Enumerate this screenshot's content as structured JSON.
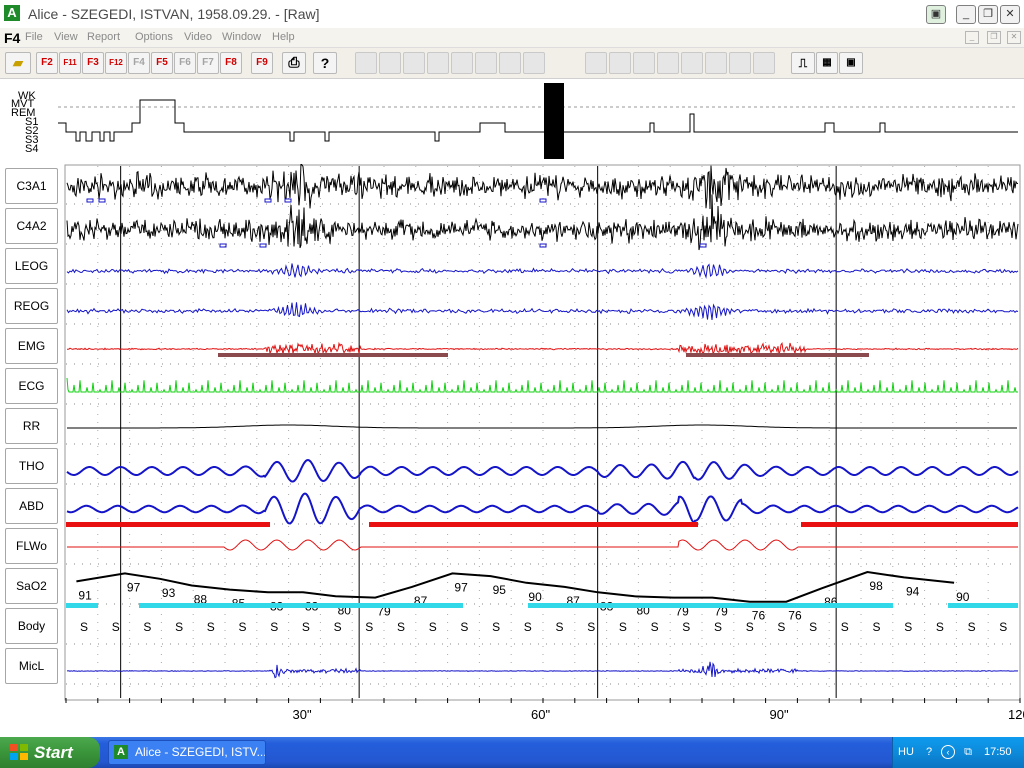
{
  "window": {
    "app_icon": "A",
    "title": "Alice - SZEGEDI, ISTVAN, 1958.09.29.  - [Raw]"
  },
  "menu": {
    "logo": "F4",
    "items": [
      "File",
      "View",
      "Report",
      "Options",
      "Video",
      "Window",
      "Help"
    ]
  },
  "toolbar": {
    "buttons": [
      "F2",
      "F11",
      "F3",
      "F12",
      "F4",
      "F5",
      "F6",
      "F7",
      "F8",
      "F9"
    ]
  },
  "hypnogram": {
    "stages": [
      "WK",
      "MVT",
      "REM",
      "S1",
      "S2",
      "S3",
      "S4"
    ]
  },
  "channels": [
    "C3A1",
    "C4A2",
    "LEOG",
    "REOG",
    "EMG",
    "ECG",
    "RR",
    "THO",
    "ABD",
    "FLWo",
    "SaO2",
    "Body",
    "MicL"
  ],
  "sao2": {
    "values": [
      {
        "t": 0.3,
        "v": "91"
      },
      {
        "t": 6.4,
        "v": "97"
      },
      {
        "t": 10.8,
        "v": "93"
      },
      {
        "t": 14.8,
        "v": "88"
      },
      {
        "t": 19.6,
        "v": "85"
      },
      {
        "t": 24.4,
        "v": "83"
      },
      {
        "t": 28.8,
        "v": "83"
      },
      {
        "t": 32.9,
        "v": "80"
      },
      {
        "t": 37.9,
        "v": "79"
      },
      {
        "t": 42.5,
        "v": "87"
      },
      {
        "t": 47.6,
        "v": "97"
      },
      {
        "t": 52.4,
        "v": "95"
      },
      {
        "t": 56.9,
        "v": "90"
      },
      {
        "t": 61.7,
        "v": "87"
      },
      {
        "t": 65.9,
        "v": "83"
      },
      {
        "t": 70.5,
        "v": "80"
      },
      {
        "t": 75.4,
        "v": "79"
      },
      {
        "t": 80.3,
        "v": "79"
      },
      {
        "t": 85.0,
        "v": "76"
      },
      {
        "t": 89.6,
        "v": "76"
      },
      {
        "t": 94.1,
        "v": "86"
      },
      {
        "t": 99.8,
        "v": "98"
      },
      {
        "t": 104.4,
        "v": "94"
      },
      {
        "t": 110.7,
        "v": "90"
      }
    ]
  },
  "body_position": "S",
  "time_axis": {
    "labels": [
      {
        "t": 30,
        "text": "30\""
      },
      {
        "t": 60,
        "text": "60\""
      },
      {
        "t": 90,
        "text": "90\""
      },
      {
        "t": 120,
        "text": "120\""
      }
    ]
  },
  "taskbar": {
    "start_label": "Start",
    "task_label": "Alice - SZEGEDI, ISTV...",
    "task_icon": "A",
    "language": "HU",
    "clock": "17:50"
  },
  "colors": {
    "eeg": "#000000",
    "eog": "#1414c8",
    "emg": "#e01010",
    "ecg": "#10d010",
    "resp": "#1414c8",
    "flow": "#e01010",
    "event_red": "#e81010",
    "desat": "#30d8e8",
    "arousal": "#8b4a4e",
    "mic": "#1414c8"
  }
}
